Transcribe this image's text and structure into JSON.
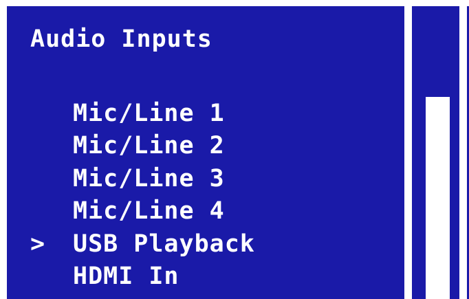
{
  "menu": {
    "title": "Audio Inputs",
    "cursor_symbol": ">",
    "selected_index": 4,
    "items": [
      {
        "label": "Mic/Line 1"
      },
      {
        "label": "Mic/Line 2"
      },
      {
        "label": "Mic/Line 3"
      },
      {
        "label": "Mic/Line 4"
      },
      {
        "label": "USB Playback"
      },
      {
        "label": "HDMI In"
      }
    ]
  },
  "level_meter": {
    "level_fraction": 0.69
  },
  "colors": {
    "background": "#1a1aa8",
    "foreground": "#ffffff"
  }
}
